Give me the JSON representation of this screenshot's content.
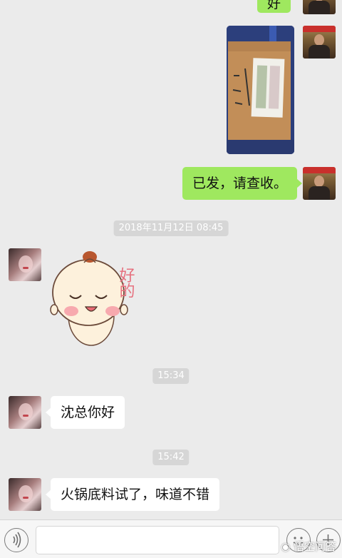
{
  "messages": {
    "top_partial_text": "好",
    "sent_reply": "已发，请查收。",
    "time_1": "2018年11月12日 08:45",
    "sticker_text": "好的",
    "time_2": "15:34",
    "greeting": "沈总你好",
    "time_3": "15:42",
    "feedback": "火锅底料试了，味道不错"
  },
  "colors": {
    "chat_background": "#ebebeb",
    "sent_bubble": "#9fe85f",
    "received_bubble": "#ffffff",
    "timestamp_bg": "#d6d6d6"
  },
  "icons": [
    "voice-icon",
    "emoji-icon",
    "plus-icon",
    "camera-icon"
  ],
  "watermark": "悟空问答"
}
